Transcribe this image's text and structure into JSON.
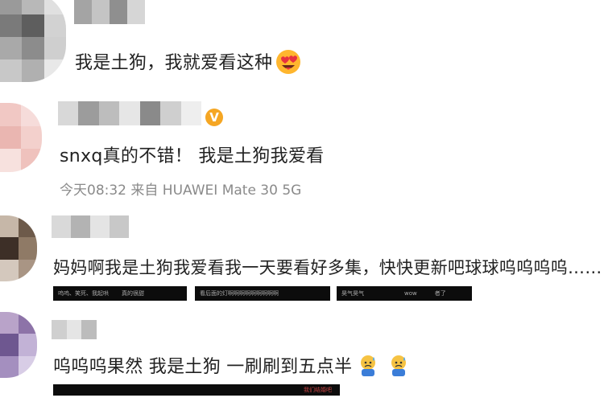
{
  "comments": [
    {
      "text": "我是土狗，我就爱看这种"
    },
    {
      "text": "snxq真的不错！ 我是土狗我爱看",
      "badge": "V",
      "meta": "今天08:32  来自 HUAWEI Mate 30 5G"
    },
    {
      "text": "妈妈啊我是土狗我爱看我一天要看好多集，快快更新吧球球呜呜呜呜……",
      "thumbnails": [
        {
          "labels": [
            "呜呜、笑死、我起哄",
            "真的很甜"
          ]
        },
        {
          "labels": [
            "看后面的灯啊啊啊啊啊啊啊啊啊"
          ]
        },
        {
          "labels": [
            "昊气昊气",
            "wow",
            "者了"
          ]
        }
      ]
    },
    {
      "text": "呜呜呜果然 我是土狗 一刷刷到五点半",
      "thumbnail_label": "我们结婚吧"
    }
  ],
  "colors": {
    "badge": "#f5a623",
    "meta": "#8a8a8a",
    "thumb": "#0c0c0c"
  }
}
